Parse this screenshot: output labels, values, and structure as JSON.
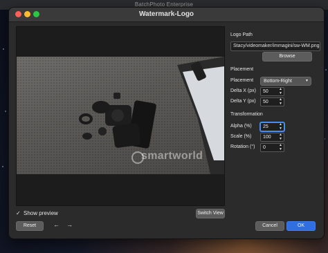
{
  "background": {
    "app_title": "BatchPhoto Enterprise"
  },
  "window": {
    "title": "Watermark-Logo",
    "controls": [
      "close",
      "minimize",
      "zoom"
    ]
  },
  "preview": {
    "watermark_text": "smartworld",
    "show_preview_label": "Show preview",
    "show_preview_checked": true,
    "show_preview_check": "✓",
    "switch_view_label": "Switch View"
  },
  "footer": {
    "reset_label": "Reset",
    "undo_icon": "←",
    "redo_icon": "→",
    "cancel_label": "Cancel",
    "ok_label": "OK"
  },
  "logo": {
    "section_label": "Logo Path",
    "path_value": "Stacy/videomaker/immagini/sw-WM.png",
    "browse_label": "Browse"
  },
  "placement": {
    "section_label": "Placement",
    "placement_label": "Placement",
    "placement_value": "Bottom-Right",
    "delta_x_label": "Delta X (px)",
    "delta_x_value": "50",
    "delta_y_label": "Delta Y (px)",
    "delta_y_value": "50"
  },
  "transformation": {
    "section_label": "Transformation",
    "alpha_label": "Alpha (%)",
    "alpha_value": "25",
    "scale_label": "Scale (%)",
    "scale_value": "100",
    "rotation_label": "Rotation (°)",
    "rotation_value": "0"
  },
  "colors": {
    "primary_button": "#2f6fe0",
    "focus_ring": "#4a8cf5",
    "window_bg": "#2b2b2b"
  }
}
